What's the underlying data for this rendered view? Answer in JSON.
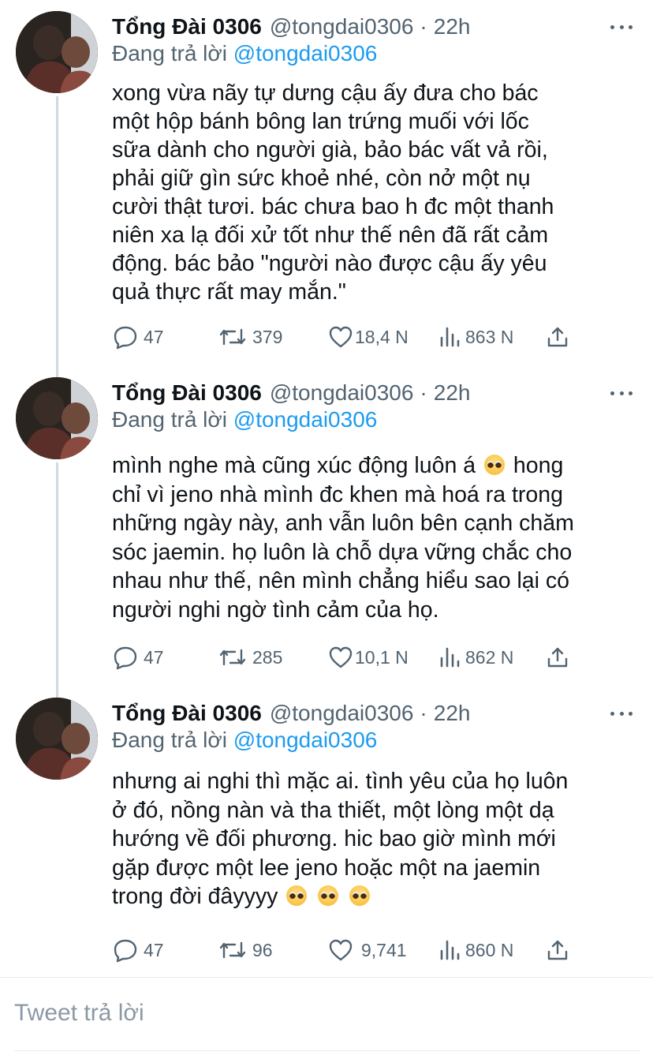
{
  "tweets": [
    {
      "name": "Tổng Đài 0306",
      "handle": "@tongdai0306",
      "time": "22h",
      "replying_label": "Đang trả lời",
      "replying_to": "@tongdai0306",
      "text": "xong vừa nãy tự dưng cậu ấy đưa cho bác\nmột hộp bánh bông lan trứng muối với lốc\nsữa dành cho người già, bảo bác vất vả rồi,\nphải giữ gìn sức khoẻ nhé, còn nở một nụ\ncười thật tươi. bác chưa bao h đc một thanh\nniên xa lạ đối xử tốt như thế nên đã rất cảm\nđộng. bác bảo \"người nào được cậu ấy yêu\nquả thực rất may mắn.\"",
      "replies": "47",
      "retweets": "379",
      "likes": "18,4 N",
      "views": "863 N"
    },
    {
      "name": "Tổng Đài 0306",
      "handle": "@tongdai0306",
      "time": "22h",
      "replying_label": "Đang trả lời",
      "replying_to": "@tongdai0306",
      "text_a": "mình nghe mà cũng xúc động luôn á",
      "text_b": " hong\nchỉ vì jeno nhà mình đc khen mà hoá ra trong\nnhững ngày này, anh vẫn luôn bên cạnh chăm\nsóc jaemin. họ luôn là chỗ dựa vững chắc cho\nnhau như thế, nên mình chẳng hiểu sao lại có\nngười nghi ngờ tình cảm của họ.",
      "replies": "47",
      "retweets": "285",
      "likes": "10,1 N",
      "views": "862 N"
    },
    {
      "name": "Tổng Đài 0306",
      "handle": "@tongdai0306",
      "time": "22h",
      "replying_label": "Đang trả lời",
      "replying_to": "@tongdai0306",
      "text": "nhưng ai nghi thì mặc ai. tình yêu của họ luôn\nở đó, nồng nàn và tha thiết, một lòng một dạ\nhướng về đối phương. hic bao giờ mình mới\ngặp được một lee jeno hoặc một na jaemin\ntrong đời đâyyyy",
      "replies": "47",
      "retweets": "96",
      "likes": "9,741",
      "views": "860 N"
    }
  ],
  "emoji_name": "pleading-face",
  "reply_box": {
    "placeholder": "Tweet trả lời"
  },
  "colors": {
    "link": "#1d9bf0",
    "secondary": "#536471",
    "thread_line": "#cfd9de"
  }
}
